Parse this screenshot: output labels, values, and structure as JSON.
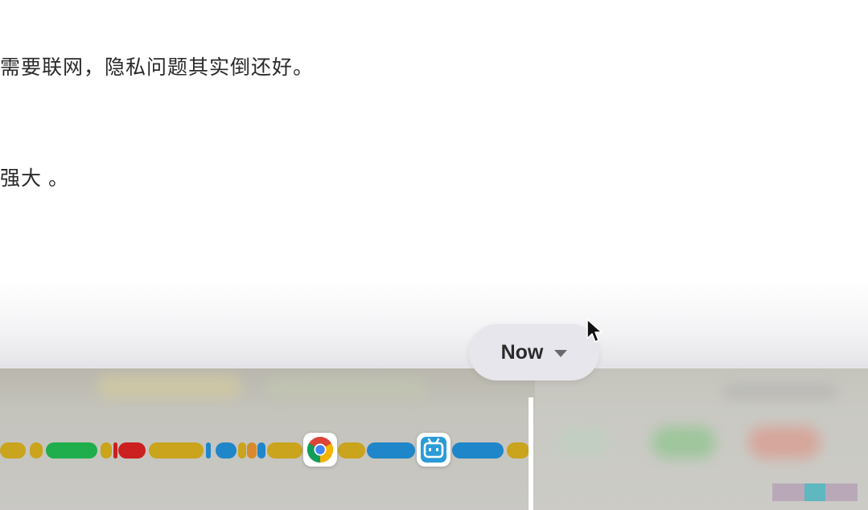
{
  "document": {
    "lines": [
      "需要联网，隐私问题其实倒还好。",
      "强大 。"
    ]
  },
  "timeline": {
    "now_label": "Now",
    "apps": [
      {
        "icon": "chrome-icon",
        "name": "Chrome"
      },
      {
        "icon": "bilibili-icon",
        "name": "bilibili"
      }
    ],
    "colors": {
      "yellow": "#c9a41c",
      "green": "#1fae4b",
      "red": "#cc1f1f",
      "blue": "#1f86c9",
      "orange": "#d98a2b",
      "now_line": "#ffffff"
    }
  }
}
